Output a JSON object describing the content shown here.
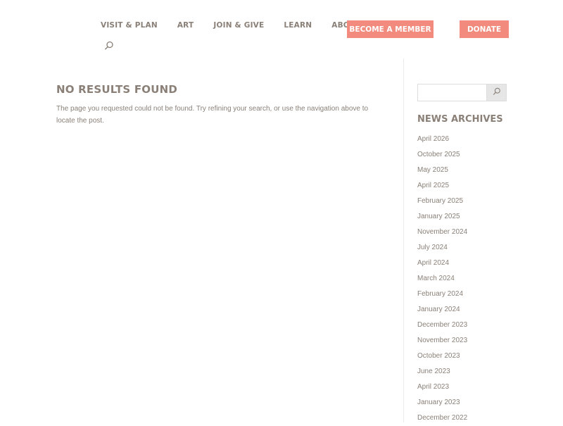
{
  "nav": {
    "items": [
      {
        "label": "VISIT & PLAN"
      },
      {
        "label": "ART"
      },
      {
        "label": "JOIN & GIVE"
      },
      {
        "label": "LEARN"
      },
      {
        "label": "ABOUT"
      }
    ],
    "member_label": "BECOME A MEMBER",
    "donate_label": "DONATE"
  },
  "main": {
    "title": "NO RESULTS FOUND",
    "message": "The page you requested could not be found. Try refining your search, or use the navigation above to locate the post."
  },
  "sidebar": {
    "search_placeholder": "",
    "archives_title": "NEWS ARCHIVES",
    "archives": [
      "April 2026",
      "October 2025",
      "May 2025",
      "April 2025",
      "February 2025",
      "January 2025",
      "November 2024",
      "July 2024",
      "April 2024",
      "March 2024",
      "February 2024",
      "January 2024",
      "December 2023",
      "November 2023",
      "October 2023",
      "June 2023",
      "April 2023",
      "January 2023",
      "December 2022"
    ]
  },
  "colors": {
    "accent": "#f28b7d",
    "text": "#8a8078"
  },
  "icons": {
    "search": "search-icon"
  }
}
